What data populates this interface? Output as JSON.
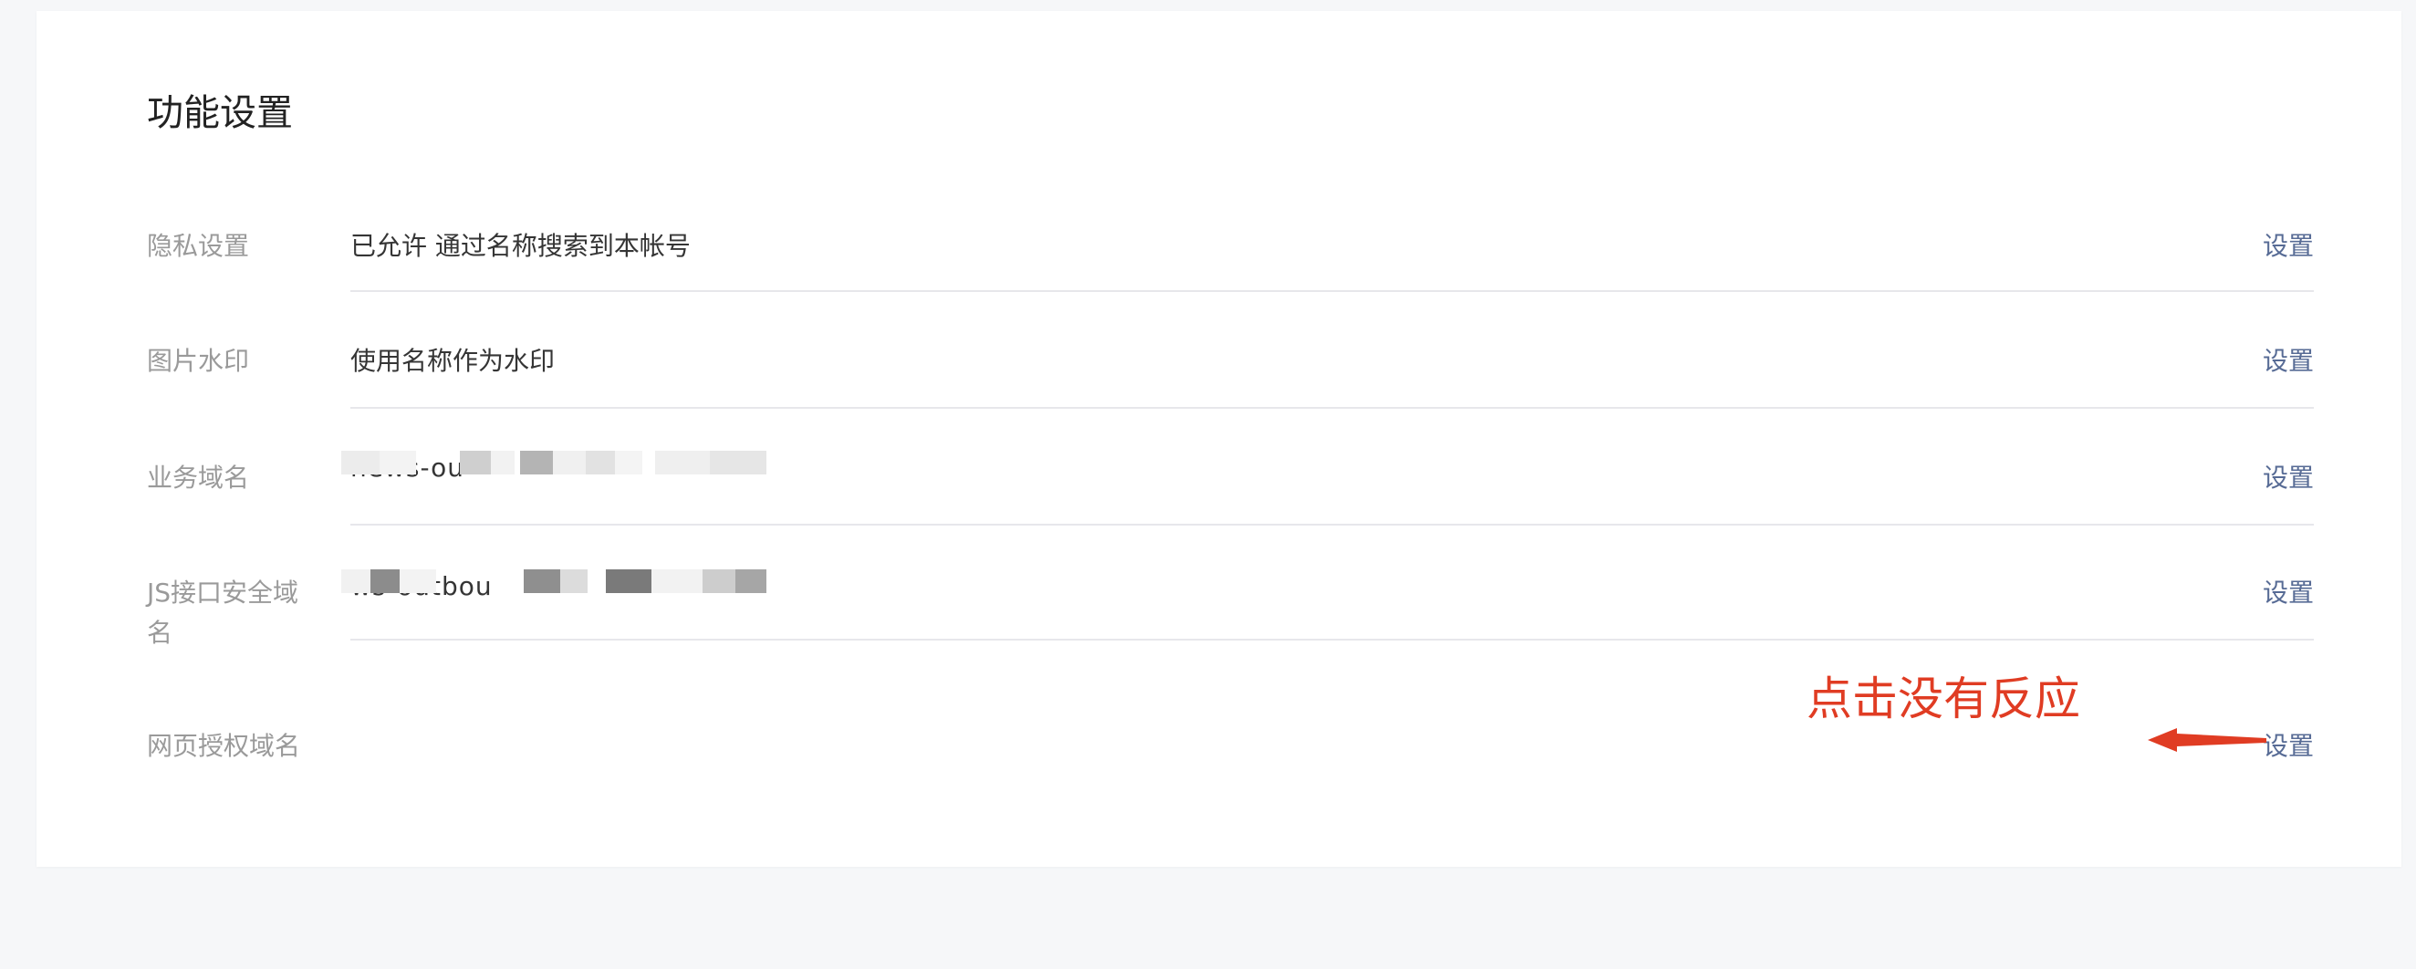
{
  "page": {
    "title": "功能设置"
  },
  "rows": [
    {
      "label": "隐私设置",
      "value": "已允许 通过名称搜索到本帐号",
      "action": "设置"
    },
    {
      "label": "图片水印",
      "value": "使用名称作为水印",
      "action": "设置"
    },
    {
      "label": "业务域名",
      "value": "news-ou",
      "action": "设置"
    },
    {
      "label": "JS接口安全域名",
      "value": "ws-outbou",
      "action": "设置"
    },
    {
      "label": "网页授权域名",
      "value": "",
      "action": "设置"
    }
  ],
  "annotation": {
    "text": "点击没有反应",
    "color": "#e03c23"
  },
  "colors": {
    "link": "#576b95",
    "label": "#9a9a9a",
    "value": "#353535",
    "divider": "#e7e7eb",
    "background": "#f6f7f9"
  }
}
